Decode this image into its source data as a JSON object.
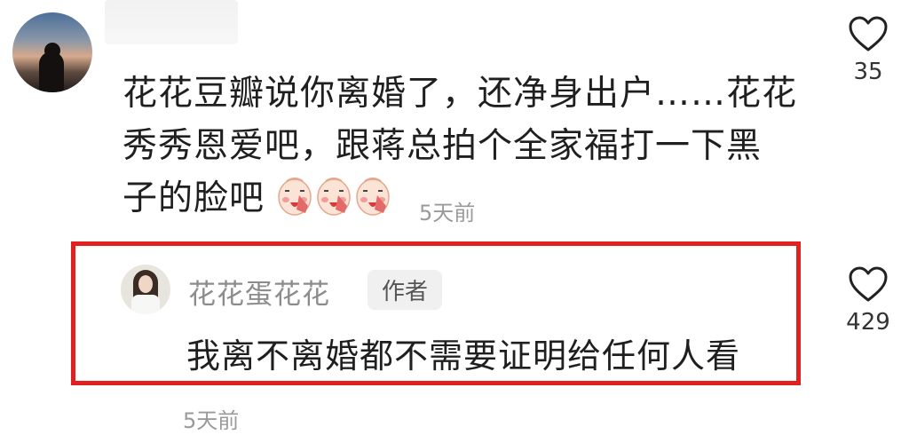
{
  "comment1": {
    "text_line1": "花花豆瓣说你离婚了，还净身出户……花花",
    "text_line2": "秀秀恩爱吧，跟蒋总拍个全家福打一下黑",
    "text_line3": "子的脸吧",
    "emoji_icons": [
      "facepalm-emoji-icon",
      "facepalm-emoji-icon",
      "facepalm-emoji-icon"
    ],
    "time": "5天前",
    "likes": "35"
  },
  "reply": {
    "username": "花花蛋花花",
    "badge": "作者",
    "text": "我离不离婚都不需要证明给任何人看",
    "time": "5天前",
    "likes": "429"
  },
  "colors": {
    "highlight_border": "#e0211f",
    "timestamp": "#9a9a9a",
    "username": "#8c8c8c"
  }
}
